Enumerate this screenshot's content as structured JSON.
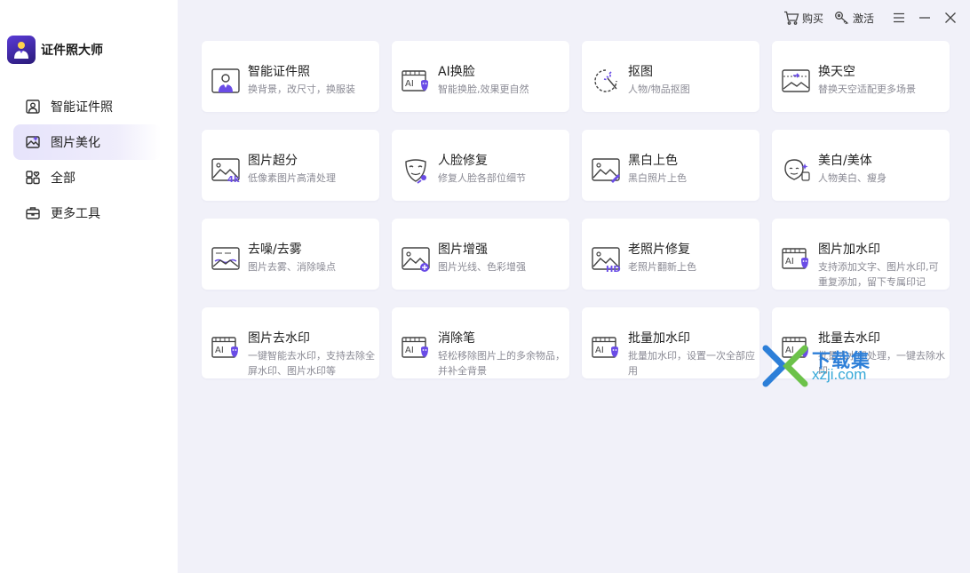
{
  "app": {
    "name": "证件照大师"
  },
  "sidebar": {
    "items": [
      {
        "label": "智能证件照",
        "icon": "id-photo-icon"
      },
      {
        "label": "图片美化",
        "icon": "image-beautify-icon",
        "active": true
      },
      {
        "label": "全部",
        "icon": "grid-heart-icon"
      },
      {
        "label": "更多工具",
        "icon": "toolbox-icon"
      }
    ]
  },
  "topbar": {
    "buy": "购买",
    "activate": "激活"
  },
  "tools": [
    {
      "title": "智能证件照",
      "desc": "换背景，改尺寸，换服装",
      "icon": "id-photo-icon"
    },
    {
      "title": "AI换脸",
      "desc": "智能换脸,效果更自然",
      "icon": "ai-face-swap-icon"
    },
    {
      "title": "抠图",
      "desc": "人物/物品抠图",
      "icon": "cutout-icon"
    },
    {
      "title": "换天空",
      "desc": "替换天空适配更多场景",
      "icon": "sky-replace-icon"
    },
    {
      "title": "图片超分",
      "desc": "低像素图片高清处理",
      "icon": "upscale-4k-icon"
    },
    {
      "title": "人脸修复",
      "desc": "修复人脸各部位细节",
      "icon": "face-repair-icon"
    },
    {
      "title": "黑白上色",
      "desc": "黑白照片上色",
      "icon": "colorize-icon"
    },
    {
      "title": "美白/美体",
      "desc": "人物美白、瘦身",
      "icon": "beauty-icon"
    },
    {
      "title": "去噪/去雾",
      "desc": "图片去雾、消除噪点",
      "icon": "denoise-icon"
    },
    {
      "title": "图片增强",
      "desc": "图片光线、色彩增强",
      "icon": "enhance-icon"
    },
    {
      "title": "老照片修复",
      "desc": "老照片翻新上色",
      "icon": "old-photo-hd-icon"
    },
    {
      "title": "图片加水印",
      "desc": "支持添加文字、图片水印,可重复添加，留下专属印记",
      "icon": "add-watermark-icon"
    },
    {
      "title": "图片去水印",
      "desc": "一键智能去水印，支持去除全屏水印、图片水印等",
      "icon": "remove-watermark-icon"
    },
    {
      "title": "消除笔",
      "desc": "轻松移除图片上的多余物品，并补全背景",
      "icon": "eraser-pen-icon"
    },
    {
      "title": "批量加水印",
      "desc": "批量加水印，设置一次全部应用",
      "icon": "batch-add-watermark-icon"
    },
    {
      "title": "批量去水印",
      "desc": "批量去水印处理，一键去除水印",
      "icon": "batch-remove-watermark-icon"
    }
  ],
  "watermark": {
    "top": "下载集",
    "bottom": "xzji.com"
  },
  "colors": {
    "accent": "#6a4ce6",
    "sidebar_bg": "#ffffff",
    "content_bg": "#f1f1f9",
    "active_item_bg": "#e6e3fb"
  }
}
